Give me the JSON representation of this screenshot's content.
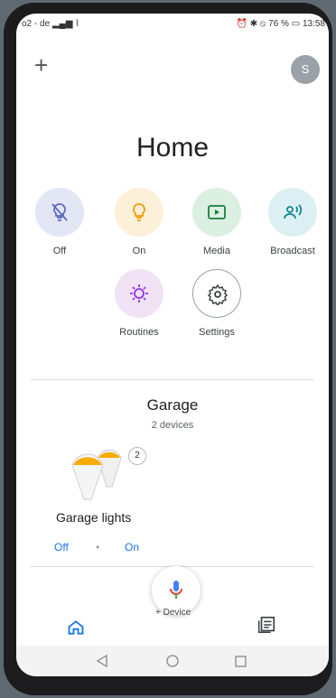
{
  "status_bar": {
    "carrier": "o2 - de",
    "battery_percent": "76 %",
    "time": "13:58"
  },
  "header": {
    "add_icon": "+",
    "avatar_initial": "S",
    "title": "Home"
  },
  "actions": [
    {
      "label": "Off",
      "icon": "light-off-icon",
      "bg": "#e3e6f5",
      "fg": "#5c6bc0"
    },
    {
      "label": "On",
      "icon": "lightbulb-icon",
      "bg": "#fdf0d9",
      "fg": "#f29900"
    },
    {
      "label": "Media",
      "icon": "play-icon",
      "bg": "#dcefe3",
      "fg": "#188038"
    },
    {
      "label": "Broadcast",
      "icon": "broadcast-icon",
      "bg": "#dcf0f3",
      "fg": "#12858f"
    },
    {
      "label": "Routines",
      "icon": "routines-icon",
      "bg": "#f1e2f6",
      "fg": "#9334e6"
    },
    {
      "label": "Settings",
      "icon": "gear-icon",
      "bg": "#ffffff",
      "fg": "#3c4043"
    }
  ],
  "room": {
    "name": "Garage",
    "device_count": "2 devices",
    "device": {
      "name": "Garage lights",
      "badge": "2",
      "off_label": "Off",
      "on_label": "On"
    }
  },
  "mic_caption": "+ Device",
  "colors": {
    "accent": "#1a73e8",
    "bulb_yellow": "#f9ab00"
  }
}
